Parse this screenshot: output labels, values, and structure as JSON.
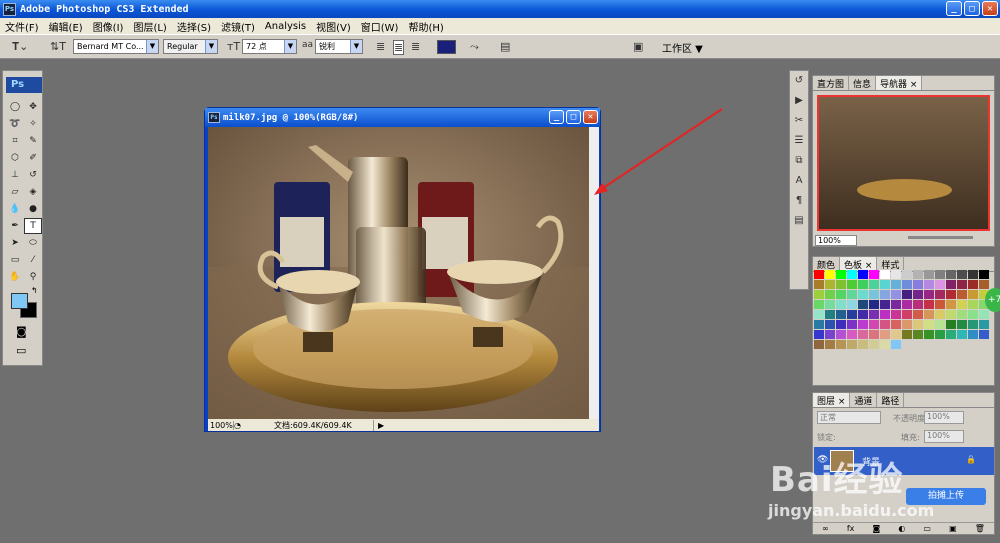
{
  "app": {
    "title": "Adobe Photoshop CS3 Extended",
    "logo": "Ps"
  },
  "menu": [
    "文件(F)",
    "编辑(E)",
    "图像(I)",
    "图层(L)",
    "选择(S)",
    "滤镜(T)",
    "Analysis",
    "视图(V)",
    "窗口(W)",
    "帮助(H)"
  ],
  "options": {
    "font_family": "Bernard MT Co...",
    "font_style": "Regular",
    "font_size": "72 点",
    "anti_alias_label": "aa",
    "anti_alias": "锐利",
    "text_color": "#1a1f7a",
    "workspace": "工作区 ▼"
  },
  "toolbox": {
    "logo": "Ps",
    "fg_color": "#7fc7f4",
    "bg_color": "#000000"
  },
  "document": {
    "title": "milk07.jpg @ 100%(RGB/8#)",
    "zoom": "100%",
    "doc_info": "文档:609.4K/609.4K"
  },
  "navigator": {
    "tabs": [
      "直方图",
      "信息",
      "导航器 ×"
    ],
    "zoom": "100%"
  },
  "swatches": {
    "tabs": [
      "颜色",
      "色板 ×",
      "样式"
    ]
  },
  "layers": {
    "tabs": [
      "图层 ×",
      "通道",
      "路径"
    ],
    "blend_mode": "正常",
    "opacity_label": "不透明度:",
    "opacity": "100%",
    "lock_label": "锁定:",
    "fill_label": "填充:",
    "fill": "100%",
    "layer_name": "背景"
  },
  "watermark": {
    "brand": "Bai经验",
    "url": "jingyan.baidu.com",
    "upload": "拍摊上传"
  },
  "colors": {
    "titlebar": "#0b56d6",
    "arrow": "#e62222"
  }
}
